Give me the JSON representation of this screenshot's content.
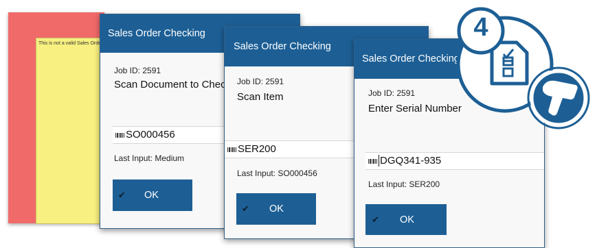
{
  "error_panel": {
    "message": "This is not a valid Sales Order"
  },
  "windows": [
    {
      "title": "Sales Order Checking",
      "job_id": "Job ID: 2591",
      "prompt": "Scan Document to Check",
      "input_value": "SO000456",
      "last_input": "Last Input: Medium",
      "ok_label": "OK"
    },
    {
      "title": "Sales Order Checking",
      "job_id": "Job ID: 2591",
      "prompt": "Scan Item",
      "input_value": "SER200",
      "last_input": "Last Input: SO000456",
      "ok_label": "OK"
    },
    {
      "title": "Sales Order Checking",
      "job_id": "Job ID: 2591",
      "prompt": "Enter Serial Number",
      "input_value": "DGQ341-935",
      "last_input": "Last Input: SER200",
      "ok_label": "OK"
    }
  ],
  "step_badge": {
    "number": "4"
  },
  "icons": {
    "barcode": "barcode-icon",
    "check": "checkmark-icon",
    "document": "checklist-document-icon",
    "scanner": "barcode-scanner-icon"
  },
  "colors": {
    "titlebar": "#1d5f95",
    "error_red": "#f06a6a",
    "error_yellow": "#f8f080",
    "accent_blue": "#1d5f95"
  }
}
